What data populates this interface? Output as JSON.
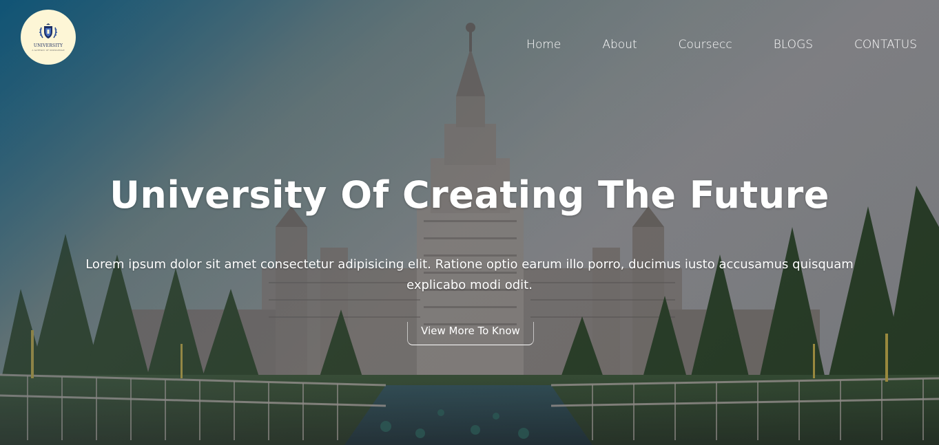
{
  "logo": {
    "name": "UNIVERSITY",
    "tagline": "A GATEWAY OF KNOWLEDGE",
    "crest_icon": "shield-laurel-icon"
  },
  "nav": {
    "items": [
      {
        "label": "Home"
      },
      {
        "label": "About"
      },
      {
        "label": "Coursecc"
      },
      {
        "label": "BLOGS"
      },
      {
        "label": "CONTATUS"
      }
    ]
  },
  "hero": {
    "title": "University Of Creating The Future",
    "description": "Lorem ipsum dolor sit amet consectetur adipisicing elit. Ratione optio earum illo porro, ducimus iusto accusamus quisquam explicabo modi odit.",
    "cta_label": "View More To Know",
    "background_image": "university-building-photo"
  },
  "colors": {
    "text": "#ffffff",
    "logo_bg": "#fdf6d6",
    "logo_text": "#1c2f66",
    "overlay_accent": "#08608c"
  }
}
